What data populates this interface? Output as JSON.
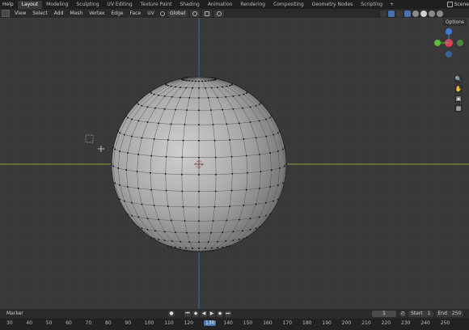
{
  "topbar": {
    "help": "Help",
    "tabs": [
      "Layout",
      "Modeling",
      "Sculpting",
      "UV Editing",
      "Texture Paint",
      "Shading",
      "Animation",
      "Rendering",
      "Compositing",
      "Geometry Nodes",
      "Scripting"
    ],
    "active_tab": "Layout",
    "add_tab": "+",
    "scene": "Scene"
  },
  "header": {
    "menus": [
      "View",
      "Select",
      "Add",
      "Mesh",
      "Vertex",
      "Edge",
      "Face",
      "UV"
    ],
    "transform_orientation": "Global",
    "options": "Options"
  },
  "timeline": {
    "marker": "Marker",
    "current_frame": "1",
    "start_label": "Start",
    "start_value": "1",
    "end_label": "End",
    "end_value": "250",
    "ruler_ticks": [
      "30",
      "40",
      "50",
      "60",
      "70",
      "80",
      "90",
      "100",
      "110",
      "120",
      "130",
      "140",
      "150",
      "160",
      "170",
      "180",
      "190",
      "200",
      "210",
      "220",
      "230",
      "240",
      "250"
    ],
    "current_tick": "130"
  },
  "colors": {
    "accent": "#4772b3",
    "viewport_bg": "#393939",
    "x_axis": "#8fa03a",
    "z_axis": "#3e63b4",
    "gizmo_x": "#e04050",
    "gizmo_y": "#5bbd3a",
    "gizmo_z": "#3e7bd9"
  }
}
